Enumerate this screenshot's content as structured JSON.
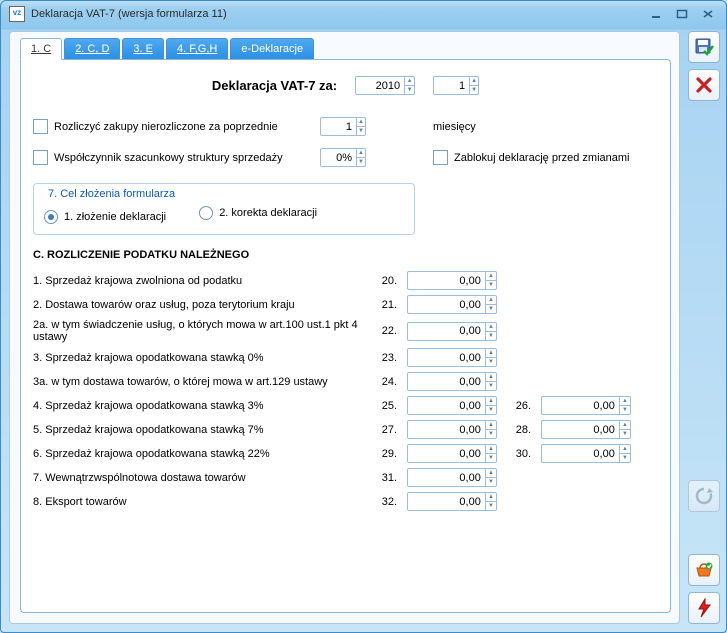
{
  "window": {
    "title": "Deklaracja VAT-7 (wersja formularza 11)",
    "app_icon_text": "vz"
  },
  "tabs": [
    {
      "label": "1. C"
    },
    {
      "label": "2. C, D"
    },
    {
      "label": "3. E"
    },
    {
      "label": "4. F,G,H"
    },
    {
      "label": "e-Deklaracje"
    }
  ],
  "header": {
    "label": "Deklaracja VAT-7 za:",
    "year": "2010",
    "month": "1"
  },
  "option_rozlicz": {
    "label": "Rozliczyć zakupy nierozliczone za poprzednie",
    "value": "1",
    "suffix": "miesięcy"
  },
  "option_wspolczynnik": {
    "label": "Współczynnik szacunkowy struktury sprzedaży",
    "value": "0%"
  },
  "option_zablokuj": {
    "label": "Zablokuj deklarację przed zmianami"
  },
  "fieldset7": {
    "legend": "7. Cel złożenia formularza",
    "opt1": "1. złożenie deklaracji",
    "opt2": "2. korekta deklaracji"
  },
  "sectionC": {
    "heading": "C. ROZLICZENIE PODATKU NALEŻNEGO",
    "rows": [
      {
        "label": "1. Sprzedaż krajowa zwolniona od podatku",
        "n1": "20.",
        "v1": "0,00"
      },
      {
        "label": "2. Dostawa towarów oraz usług, poza terytorium kraju",
        "n1": "21.",
        "v1": "0,00"
      },
      {
        "label": "2a. w tym świadczenie usług, o których mowa w art.100 ust.1 pkt 4 ustawy",
        "n1": "22.",
        "v1": "0,00"
      },
      {
        "label": "3. Sprzedaż krajowa opodatkowana stawką 0%",
        "n1": "23.",
        "v1": "0,00"
      },
      {
        "label": "3a. w tym dostawa towarów, o której mowa w art.129 ustawy",
        "n1": "24.",
        "v1": "0,00"
      },
      {
        "label": "4. Sprzedaż krajowa opodatkowana stawką 3%",
        "n1": "25.",
        "v1": "0,00",
        "n2": "26.",
        "v2": "0,00"
      },
      {
        "label": "5. Sprzedaż krajowa opodatkowana stawką 7%",
        "n1": "27.",
        "v1": "0,00",
        "n2": "28.",
        "v2": "0,00"
      },
      {
        "label": "6. Sprzedaż krajowa opodatkowana stawką 22%",
        "n1": "29.",
        "v1": "0,00",
        "n2": "30.",
        "v2": "0,00"
      },
      {
        "label": "7. Wewnątrzwspólnotowa dostawa towarów",
        "n1": "31.",
        "v1": "0,00"
      },
      {
        "label": "8. Eksport towarów",
        "n1": "32.",
        "v1": "0,00"
      }
    ]
  }
}
